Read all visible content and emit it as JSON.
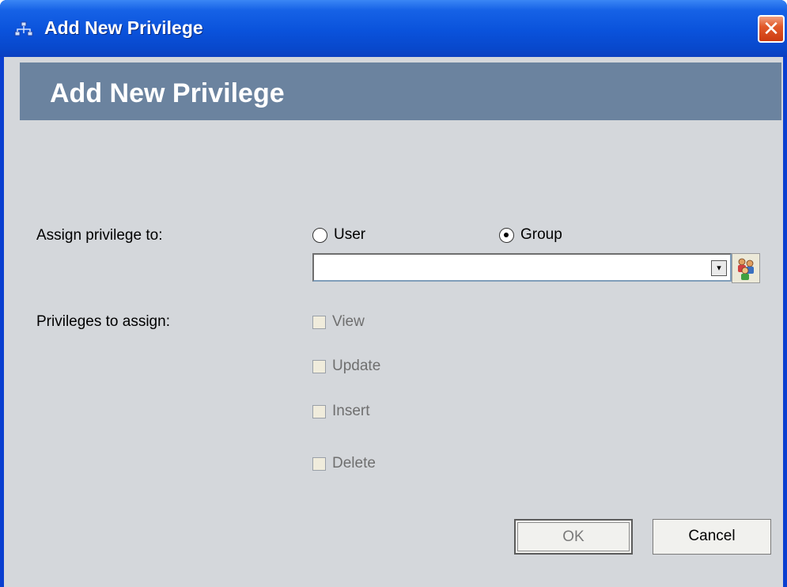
{
  "window": {
    "title": "Add New Privilege",
    "close_glyph": "✕"
  },
  "banner": {
    "title": "Add New Privilege"
  },
  "form": {
    "assign_label": "Assign privilege to:",
    "radio_options": [
      {
        "label": "User",
        "selected": false
      },
      {
        "label": "Group",
        "selected": true
      }
    ],
    "combo_value": "",
    "combo_arrow": "▾",
    "privileges_label": "Privileges to assign:",
    "privileges": [
      {
        "label": "View",
        "checked": false
      },
      {
        "label": "Update",
        "checked": false
      },
      {
        "label": "Insert",
        "checked": false
      },
      {
        "label": "Delete",
        "checked": false
      }
    ]
  },
  "buttons": {
    "ok_label": "OK",
    "cancel_label": "Cancel"
  },
  "colors": {
    "titlebar": "#0a52db",
    "banner": "#6b839f",
    "client_bg": "#d4d7db",
    "close": "#e25a2a"
  },
  "icons": {
    "title": "app-network-icon",
    "lookup": "users-group-icon"
  }
}
